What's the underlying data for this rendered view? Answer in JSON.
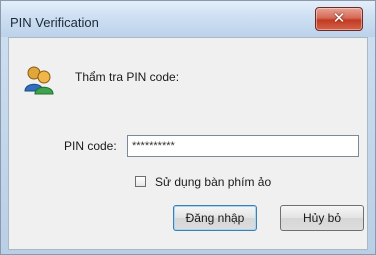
{
  "window": {
    "title": "PIN Verification",
    "close_glyph": "✕"
  },
  "dialog": {
    "prompt": "Thẩm tra PIN code:",
    "pin_label": "PIN code:",
    "pin_value": "**********",
    "virtual_keyboard_label": "Sử dụng bàn phím ảo",
    "virtual_keyboard_checked": false,
    "login_button": "Đăng nhập",
    "cancel_button": "Hủy bỏ",
    "icon": "users-icon"
  },
  "colors": {
    "close_button": "#c23b22",
    "titlebar": "#cddff2"
  }
}
